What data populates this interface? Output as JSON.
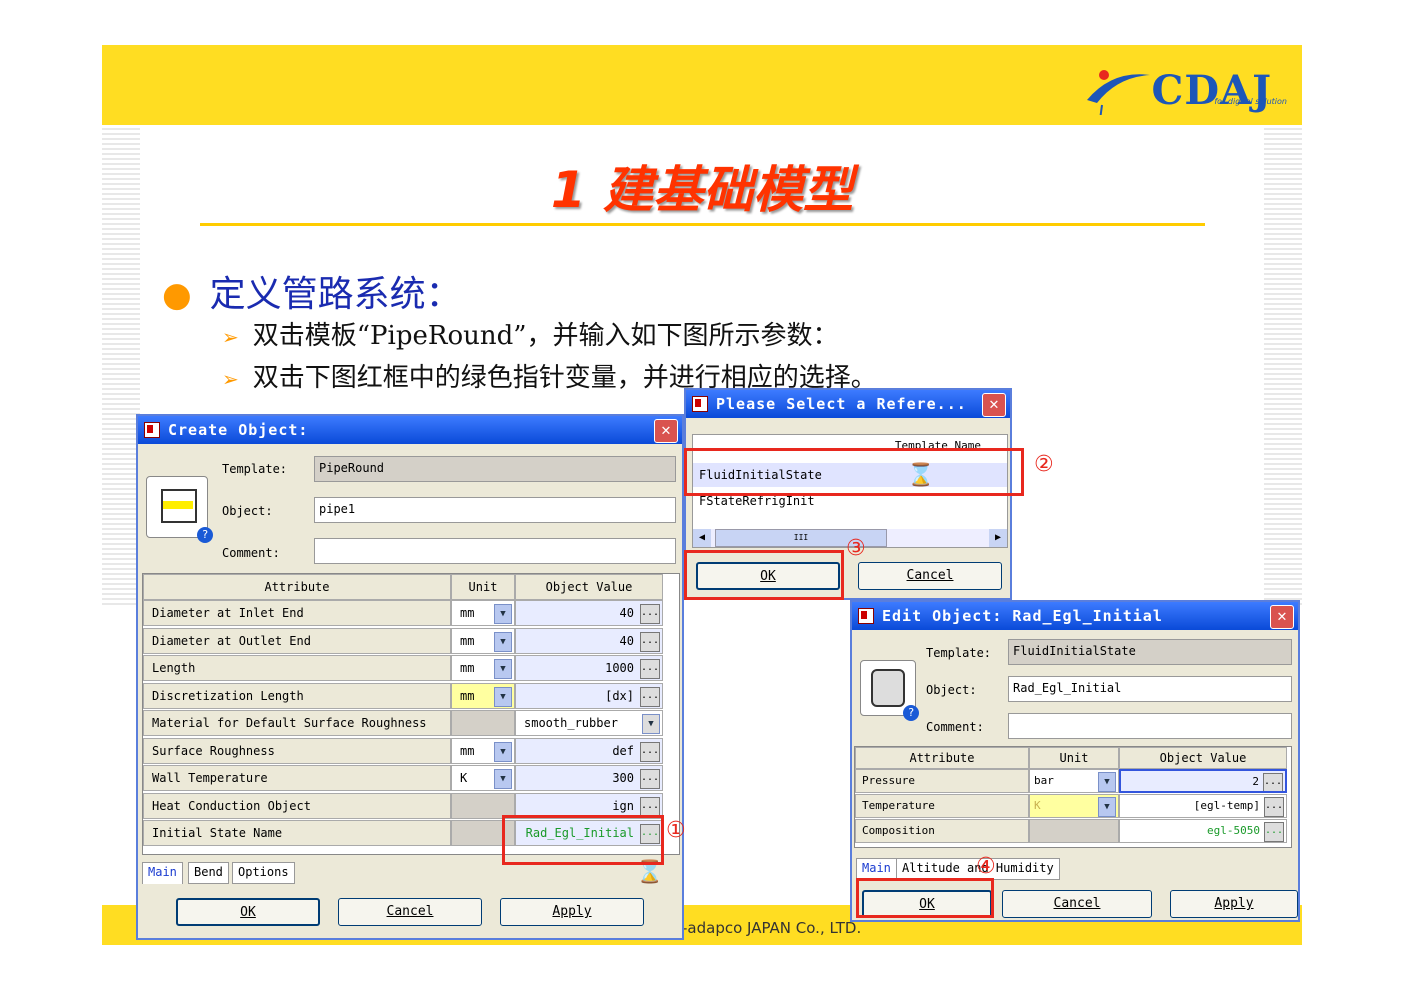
{
  "slide": {
    "title": "1 建基础模型",
    "bullet": "定义管路系统：",
    "sub1": "双击模板“PipeRound”，并输入如下图所示参数：",
    "sub2": "双击下图红框中的绿色指针变量，并进行相应的选择。",
    "footer": "-adapco JAPAN Co., LTD.",
    "logo": "CDAJ",
    "logo_sub": "for digital solution"
  },
  "create": {
    "title": "Create Object:",
    "template_label": "Template:",
    "template_value": "PipeRound",
    "object_label": "Object:",
    "object_value": "pipe1",
    "comment_label": "Comment:",
    "comment_value": "",
    "col_attr": "Attribute",
    "col_unit": "Unit",
    "col_value": "Object Value",
    "rows": [
      {
        "attr": "Diameter at Inlet End",
        "unit": "mm",
        "value": "40"
      },
      {
        "attr": "Diameter at Outlet End",
        "unit": "mm",
        "value": "40"
      },
      {
        "attr": "Length",
        "unit": "mm",
        "value": "1000"
      },
      {
        "attr": "Discretization Length",
        "unit": "mm",
        "value": "[dx]"
      },
      {
        "attr": "Material for Default Surface Roughness",
        "unit": "",
        "value": "smooth_rubber"
      },
      {
        "attr": "Surface Roughness",
        "unit": "mm",
        "value": "def"
      },
      {
        "attr": "Wall Temperature",
        "unit": "K",
        "value": "300"
      },
      {
        "attr": "Heat Conduction Object",
        "unit": "",
        "value": "ign"
      },
      {
        "attr": "Initial State Name",
        "unit": "",
        "value": "Rad_Egl_Initial"
      }
    ],
    "tabs": [
      "Main",
      "Bend",
      "Options"
    ],
    "ok": "OK",
    "cancel": "Cancel",
    "apply": "Apply"
  },
  "select": {
    "title": "Please Select a Refere...",
    "col": "Template Name",
    "items": [
      "FluidInitialState",
      "FStateRefrigInit"
    ],
    "scroll_mid": "III",
    "ok": "OK",
    "cancel": "Cancel"
  },
  "edit": {
    "title": "Edit Object: Rad_Egl_Initial",
    "template_label": "Template:",
    "template_value": "FluidInitialState",
    "object_label": "Object:",
    "object_value": "Rad_Egl_Initial",
    "comment_label": "Comment:",
    "col_attr": "Attribute",
    "col_unit": "Unit",
    "col_value": "Object Value",
    "rows": [
      {
        "attr": "Pressure",
        "unit": "bar",
        "value": "2"
      },
      {
        "attr": "Temperature",
        "unit": "K",
        "value": "[egl-temp]"
      },
      {
        "attr": "Composition",
        "unit": "",
        "value": "egl-5050"
      }
    ],
    "tabs": [
      "Main",
      "Altitude and Humidity"
    ],
    "ok": "OK",
    "cancel": "Cancel",
    "apply": "Apply"
  },
  "markers": [
    "①",
    "②",
    "③",
    "④"
  ]
}
